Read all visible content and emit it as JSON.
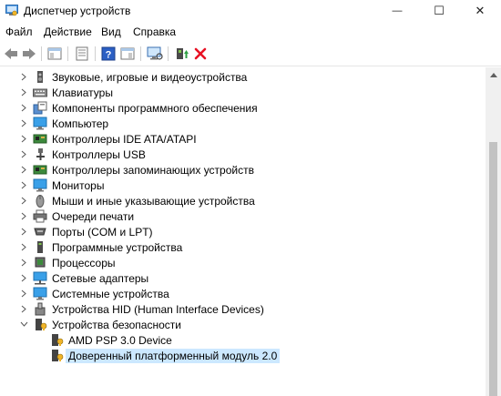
{
  "window": {
    "title": "Диспетчер устройств",
    "controls": {
      "minimize": "—",
      "maximize": "☐",
      "close": "✕"
    }
  },
  "menu": [
    "Файл",
    "Действие",
    "Вид",
    "Справка"
  ],
  "toolbar": {
    "icons": [
      "back-arrow-icon",
      "forward-arrow-icon",
      "show-hide-tree-icon",
      "properties-icon",
      "help-icon",
      "action-view-icon",
      "scan-hardware-icon",
      "update-driver-icon",
      "uninstall-icon"
    ]
  },
  "tree": {
    "items": [
      {
        "label": "Звуковые, игровые и видеоустройства",
        "icon": "speaker-icon",
        "expanded": false
      },
      {
        "label": "Клавиатуры",
        "icon": "keyboard-icon",
        "expanded": false
      },
      {
        "label": "Компоненты программного обеспечения",
        "icon": "software-component-icon",
        "expanded": false
      },
      {
        "label": "Компьютер",
        "icon": "computer-icon",
        "expanded": false
      },
      {
        "label": "Контроллеры IDE ATA/ATAPI",
        "icon": "ide-controller-icon",
        "expanded": false
      },
      {
        "label": "Контроллеры USB",
        "icon": "usb-icon",
        "expanded": false
      },
      {
        "label": "Контроллеры запоминающих устройств",
        "icon": "storage-controller-icon",
        "expanded": false
      },
      {
        "label": "Мониторы",
        "icon": "monitor-icon",
        "expanded": false
      },
      {
        "label": "Мыши и иные указывающие устройства",
        "icon": "mouse-icon",
        "expanded": false
      },
      {
        "label": "Очереди печати",
        "icon": "printer-icon",
        "expanded": false
      },
      {
        "label": "Порты (COM и LPT)",
        "icon": "port-icon",
        "expanded": false
      },
      {
        "label": "Программные устройства",
        "icon": "software-device-icon",
        "expanded": false
      },
      {
        "label": "Процессоры",
        "icon": "processor-icon",
        "expanded": false
      },
      {
        "label": "Сетевые адаптеры",
        "icon": "network-adapter-icon",
        "expanded": false
      },
      {
        "label": "Системные устройства",
        "icon": "system-device-icon",
        "expanded": false
      },
      {
        "label": "Устройства HID (Human Interface Devices)",
        "icon": "hid-icon",
        "expanded": false
      },
      {
        "label": "Устройства безопасности",
        "icon": "security-device-icon",
        "expanded": true
      },
      {
        "label": "AMD PSP 3.0 Device",
        "icon": "security-device-icon",
        "child": true
      },
      {
        "label": "Доверенный платформенный модуль 2.0",
        "icon": "security-device-icon",
        "child": true,
        "selected": true
      }
    ]
  },
  "colors": {
    "selection": "#cce8ff",
    "scrollbar_track": "#f0f0f0",
    "scrollbar_thumb": "#c2c2c2",
    "uninstall_red": "#e81123",
    "help_blue": "#2b5fc4"
  }
}
